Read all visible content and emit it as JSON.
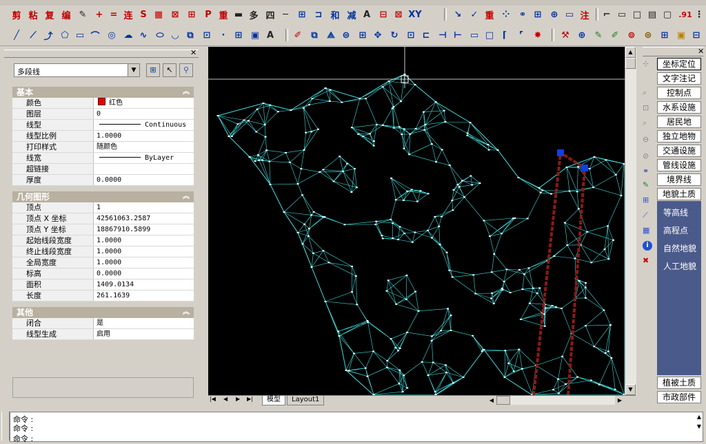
{
  "toolbar1": {
    "labels": [
      "剪",
      "粘",
      "复",
      "编",
      "",
      "+",
      "=",
      "连",
      "S",
      "",
      "",
      "",
      "",
      "重",
      "",
      "多",
      "四",
      "",
      "",
      "",
      "和",
      "减",
      "A",
      "",
      "",
      "XY"
    ],
    "right_labels": [
      "重",
      "注",
      ".91"
    ]
  },
  "toolbar2": {
    "label_A": "A",
    "label_A2": "A"
  },
  "props": {
    "object_type": "多段线",
    "sections": {
      "basic": "基本",
      "geometry": "几何图形",
      "other": "其他"
    },
    "basic_rows": [
      {
        "k": "颜色",
        "v": "红色"
      },
      {
        "k": "图层",
        "v": "0"
      },
      {
        "k": "线型",
        "v": "Continuous"
      },
      {
        "k": "线型比例",
        "v": "1.0000"
      },
      {
        "k": "打印样式",
        "v": "随颜色"
      },
      {
        "k": "线宽",
        "v": "ByLayer"
      },
      {
        "k": "超链接",
        "v": ""
      },
      {
        "k": "厚度",
        "v": "0.0000"
      }
    ],
    "geometry_rows": [
      {
        "k": "顶点",
        "v": "1"
      },
      {
        "k": "顶点 X 坐标",
        "v": "42561063.2587"
      },
      {
        "k": "顶点 Y 坐标",
        "v": "18867910.5899"
      },
      {
        "k": "起始线段宽度",
        "v": "1.0000"
      },
      {
        "k": "终止线段宽度",
        "v": "1.0000"
      },
      {
        "k": "全局宽度",
        "v": "1.0000"
      },
      {
        "k": "标高",
        "v": "0.0000"
      },
      {
        "k": "面积",
        "v": "1409.0134"
      },
      {
        "k": "长度",
        "v": "261.1639"
      }
    ],
    "other_rows": [
      {
        "k": "闭合",
        "v": "是"
      },
      {
        "k": "线型生成",
        "v": "启用"
      }
    ]
  },
  "tabs": {
    "model": "模型",
    "layout1": "Layout1"
  },
  "palette": {
    "buttons": [
      "坐标定位",
      "文字注记",
      "控制点",
      "水系设施",
      "居民地",
      "独立地物",
      "交通设施",
      "管线设施",
      "境界线",
      "地貌土质"
    ],
    "items": [
      "等高线",
      "高程点",
      "自然地貌",
      "人工地貌"
    ],
    "bottom_buttons": [
      "植被土质",
      "市政部件"
    ]
  },
  "command": {
    "line1": "命令 :",
    "line2": "命令 :",
    "line3": "命令 :"
  },
  "colors": {
    "mesh": "#40e0e0",
    "polyline": "#8b1a1a",
    "grip": "#1040e0",
    "palette_bg": "#4a5a8a"
  }
}
